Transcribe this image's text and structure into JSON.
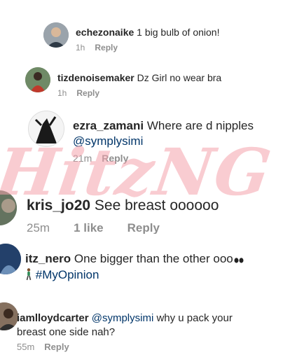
{
  "comments": [
    {
      "username": "echezonaike",
      "text": "1 big bulb of onion!",
      "time": "1h",
      "reply": "Reply"
    },
    {
      "username": "tizdenoisemaker",
      "text": "Dz Girl no wear bra",
      "time": "1h",
      "reply": "Reply"
    },
    {
      "username": "ezra_zamani",
      "text": "Where are d nipples",
      "mention": "@symplysimi",
      "time": "21m",
      "reply": "Reply"
    },
    {
      "username": "kris_jo20",
      "text": "See breast oooooo",
      "time": "25m",
      "likes": "1 like",
      "reply": "Reply"
    },
    {
      "username": "itz_nero",
      "text": "One bigger than the other ooo",
      "hashtag": "#MyOpinion"
    },
    {
      "username": "iamlloydcarter",
      "mention": "@symplysimi",
      "text": "why u pack your",
      "text2": "breast one side nah?",
      "time": "55m",
      "reply": "Reply"
    }
  ],
  "watermark": "HitzNG",
  "icons": [
    "avatar-photo",
    "eyes-emoji",
    "person-walking-emoji"
  ]
}
